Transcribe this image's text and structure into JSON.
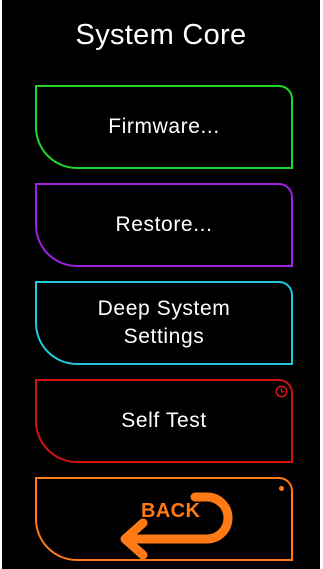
{
  "screen": {
    "title": "System Core"
  },
  "menu": {
    "firmware": {
      "label": "Firmware...",
      "color": "#22d62a"
    },
    "restore": {
      "label": "Restore...",
      "color": "#a020e0"
    },
    "deep_settings": {
      "label": "Deep System Settings",
      "color": "#22c8dc"
    },
    "self_test": {
      "label": "Self Test",
      "color": "#d01414",
      "icon": "clock-icon"
    },
    "back": {
      "label": "BACK",
      "color": "#ff7a14",
      "icon": "back-arrow-icon"
    }
  },
  "colors": {
    "background": "#000000",
    "text": "#ffffff"
  }
}
